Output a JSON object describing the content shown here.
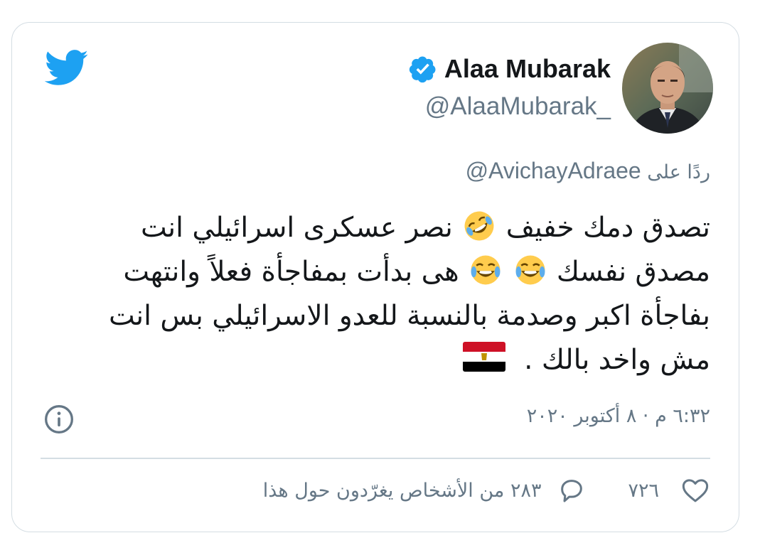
{
  "colors": {
    "twitter_blue": "#1da1f2",
    "text": "#14171a",
    "secondary_text": "#657786",
    "border": "#d4dde3"
  },
  "header": {
    "logo_icon": "twitter-bird-icon",
    "display_name": "Alaa Mubarak",
    "verified_icon": "verified-badge-icon",
    "handle": "@AlaaMubarak_",
    "avatar": "profile-avatar"
  },
  "reply_to": {
    "prefix": "ردًا على",
    "mention": "@AvichayAdraee"
  },
  "tweet": {
    "line1_a": "تصدق دمك خفيف",
    "line1_b": "نصر عسكرى اسرائيلي انت",
    "line2_a": "مصدق نفسك",
    "line2_b": "هى بدأت بمفاجأة  فعلاً  وانتهت",
    "line3": "بفاجأة اكبر وصدمة بالنسبة للعدو الاسرائيلي بس انت",
    "line4": "مش واخد بالك .",
    "emojis": [
      "rofl-emoji",
      "joy-emoji",
      "joy-emoji",
      "egypt-flag-emoji"
    ]
  },
  "timestamp": "٦:٣٢ م · ٨ أكتوبر ٢٠٢٠",
  "info_icon": "info-icon",
  "actions": {
    "like_icon": "heart-icon",
    "like_count": "٧٢٦",
    "reply_icon": "speech-bubble-icon",
    "reply_text": "٢٨٣ من الأشخاص يغرّدون حول هذا"
  }
}
